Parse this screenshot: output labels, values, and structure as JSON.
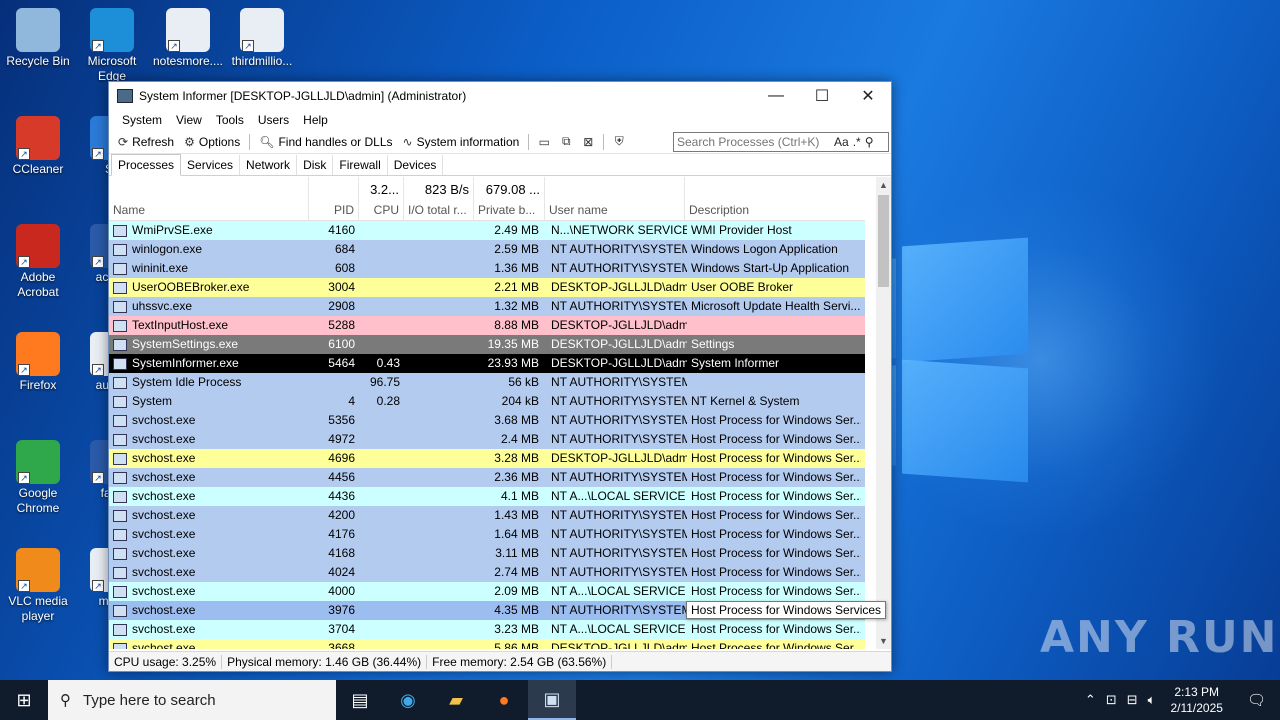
{
  "desktop": {
    "icons": [
      {
        "label": "Recycle Bin",
        "color": "#8fb8dc"
      },
      {
        "label": "Microsoft Edge",
        "color": "#1c8fd8"
      },
      {
        "label": "notesmore....",
        "color": "#e8eef4"
      },
      {
        "label": "thirdmillio...",
        "color": "#e8eef4"
      },
      {
        "label": "CCleaner",
        "color": "#d83a2a"
      },
      {
        "label": "Sk",
        "color": "#2a7ad8"
      },
      {
        "label": "Adobe Acrobat",
        "color": "#c8281e"
      },
      {
        "label": "acade",
        "color": "#2a5aa8"
      },
      {
        "label": "Firefox",
        "color": "#ff7a1e"
      },
      {
        "label": "augus",
        "color": "#e8eef4"
      },
      {
        "label": "Google Chrome",
        "color": "#2ea84a"
      },
      {
        "label": "fami",
        "color": "#2a5aa8"
      },
      {
        "label": "VLC media player",
        "color": "#f08a1a"
      },
      {
        "label": "moth",
        "color": "#e8eef4"
      }
    ],
    "watermark": "ANY RUN"
  },
  "window": {
    "title": "System Informer [DESKTOP-JGLLJLD\\admin] (Administrator)",
    "controls": {
      "minimize": "—",
      "maximize": "☐",
      "close": "✕"
    },
    "menu": [
      "System",
      "View",
      "Tools",
      "Users",
      "Help"
    ],
    "toolbar": {
      "refresh": "Refresh",
      "options": "Options",
      "find_handles": "Find handles or DLLs",
      "system_information": "System information"
    },
    "search": {
      "placeholder": "Search Processes (Ctrl+K)",
      "case_option": "Aa",
      "regex_option": ".*"
    },
    "tabs": [
      "Processes",
      "Services",
      "Network",
      "Disk",
      "Firewall",
      "Devices"
    ],
    "active_tab": "Processes",
    "columns": {
      "name": {
        "label": "Name",
        "summary": ""
      },
      "pid": {
        "label": "PID",
        "summary": ""
      },
      "cpu": {
        "label": "CPU",
        "summary": "3.2..."
      },
      "io": {
        "label": "I/O total r...",
        "summary": "823 B/s"
      },
      "private": {
        "label": "Private b...",
        "summary": "679.08 ..."
      },
      "user": {
        "label": "User name",
        "summary": ""
      },
      "desc": {
        "label": "Description",
        "summary": ""
      }
    },
    "processes": [
      {
        "name": "WmiPrvSE.exe",
        "pid": "4160",
        "cpu": "",
        "io": "",
        "private": "2.49 MB",
        "user": "N...\\NETWORK SERVICE",
        "desc": "WMI Provider Host",
        "bg": "#ccffff",
        "fg": "#000000"
      },
      {
        "name": "winlogon.exe",
        "pid": "684",
        "cpu": "",
        "io": "",
        "private": "2.59 MB",
        "user": "NT AUTHORITY\\SYSTEM",
        "desc": "Windows Logon Application",
        "bg": "#b4cbf0",
        "fg": "#000000"
      },
      {
        "name": "wininit.exe",
        "pid": "608",
        "cpu": "",
        "io": "",
        "private": "1.36 MB",
        "user": "NT AUTHORITY\\SYSTEM",
        "desc": "Windows Start-Up Application",
        "bg": "#b4cbf0",
        "fg": "#000000"
      },
      {
        "name": "UserOOBEBroker.exe",
        "pid": "3004",
        "cpu": "",
        "io": "",
        "private": "2.21 MB",
        "user": "DESKTOP-JGLLJLD\\admi",
        "desc": "User OOBE Broker",
        "bg": "#ffff99",
        "fg": "#000000"
      },
      {
        "name": "uhssvc.exe",
        "pid": "2908",
        "cpu": "",
        "io": "",
        "private": "1.32 MB",
        "user": "NT AUTHORITY\\SYSTEM",
        "desc": "Microsoft Update Health Servi...",
        "bg": "#b4cbf0",
        "fg": "#000000"
      },
      {
        "name": "TextInputHost.exe",
        "pid": "5288",
        "cpu": "",
        "io": "",
        "private": "8.88 MB",
        "user": "DESKTOP-JGLLJLD\\admi",
        "desc": "",
        "bg": "#ffc0cb",
        "fg": "#000000"
      },
      {
        "name": "SystemSettings.exe",
        "pid": "6100",
        "cpu": "",
        "io": "",
        "private": "19.35 MB",
        "user": "DESKTOP-JGLLJLD\\admi",
        "desc": "Settings",
        "bg": "#7a7a7a",
        "fg": "#ffffff"
      },
      {
        "name": "SystemInformer.exe",
        "pid": "5464",
        "cpu": "0.43",
        "io": "",
        "private": "23.93 MB",
        "user": "DESKTOP-JGLLJLD\\admi",
        "desc": "System Informer",
        "bg": "#000000",
        "fg": "#ffffff"
      },
      {
        "name": "System Idle Process",
        "pid": "",
        "cpu": "96.75",
        "io": "",
        "private": "56 kB",
        "user": "NT AUTHORITY\\SYSTEM",
        "desc": "",
        "bg": "#b4cbf0",
        "fg": "#000000"
      },
      {
        "name": "System",
        "pid": "4",
        "cpu": "0.28",
        "io": "",
        "private": "204 kB",
        "user": "NT AUTHORITY\\SYSTEM",
        "desc": "NT Kernel & System",
        "bg": "#b4cbf0",
        "fg": "#000000"
      },
      {
        "name": "svchost.exe",
        "pid": "5356",
        "cpu": "",
        "io": "",
        "private": "3.68 MB",
        "user": "NT AUTHORITY\\SYSTEM",
        "desc": "Host Process for Windows Ser...",
        "bg": "#b4cbf0",
        "fg": "#000000"
      },
      {
        "name": "svchost.exe",
        "pid": "4972",
        "cpu": "",
        "io": "",
        "private": "2.4 MB",
        "user": "NT AUTHORITY\\SYSTEM",
        "desc": "Host Process for Windows Ser...",
        "bg": "#b4cbf0",
        "fg": "#000000"
      },
      {
        "name": "svchost.exe",
        "pid": "4696",
        "cpu": "",
        "io": "",
        "private": "3.28 MB",
        "user": "DESKTOP-JGLLJLD\\admi",
        "desc": "Host Process for Windows Ser...",
        "bg": "#ffff99",
        "fg": "#000000"
      },
      {
        "name": "svchost.exe",
        "pid": "4456",
        "cpu": "",
        "io": "",
        "private": "2.36 MB",
        "user": "NT AUTHORITY\\SYSTEM",
        "desc": "Host Process for Windows Ser...",
        "bg": "#b4cbf0",
        "fg": "#000000"
      },
      {
        "name": "svchost.exe",
        "pid": "4436",
        "cpu": "",
        "io": "",
        "private": "4.1 MB",
        "user": "NT A...\\LOCAL SERVICE",
        "desc": "Host Process for Windows Ser...",
        "bg": "#ccffff",
        "fg": "#000000"
      },
      {
        "name": "svchost.exe",
        "pid": "4200",
        "cpu": "",
        "io": "",
        "private": "1.43 MB",
        "user": "NT AUTHORITY\\SYSTEM",
        "desc": "Host Process for Windows Ser...",
        "bg": "#b4cbf0",
        "fg": "#000000"
      },
      {
        "name": "svchost.exe",
        "pid": "4176",
        "cpu": "",
        "io": "",
        "private": "1.64 MB",
        "user": "NT AUTHORITY\\SYSTEM",
        "desc": "Host Process for Windows Ser...",
        "bg": "#b4cbf0",
        "fg": "#000000"
      },
      {
        "name": "svchost.exe",
        "pid": "4168",
        "cpu": "",
        "io": "",
        "private": "3.11 MB",
        "user": "NT AUTHORITY\\SYSTEM",
        "desc": "Host Process for Windows Ser...",
        "bg": "#b4cbf0",
        "fg": "#000000"
      },
      {
        "name": "svchost.exe",
        "pid": "4024",
        "cpu": "",
        "io": "",
        "private": "2.74 MB",
        "user": "NT AUTHORITY\\SYSTEM",
        "desc": "Host Process for Windows Ser...",
        "bg": "#b4cbf0",
        "fg": "#000000"
      },
      {
        "name": "svchost.exe",
        "pid": "4000",
        "cpu": "",
        "io": "",
        "private": "2.09 MB",
        "user": "NT A...\\LOCAL SERVICE",
        "desc": "Host Process for Windows Ser...",
        "bg": "#ccffff",
        "fg": "#000000"
      },
      {
        "name": "svchost.exe",
        "pid": "3976",
        "cpu": "",
        "io": "",
        "private": "4.35 MB",
        "user": "NT AUTHORITY\\SYSTEM",
        "desc": "Host Process for Windows Ser...",
        "bg": "#9cbdf0",
        "fg": "#000000"
      },
      {
        "name": "svchost.exe",
        "pid": "3704",
        "cpu": "",
        "io": "",
        "private": "3.23 MB",
        "user": "NT A...\\LOCAL SERVICE",
        "desc": "Host Process for Windows Ser...",
        "bg": "#ccffff",
        "fg": "#000000"
      },
      {
        "name": "svchost.exe",
        "pid": "3668",
        "cpu": "",
        "io": "",
        "private": "5.86 MB",
        "user": "DESKTOP-JGLLJLD\\admi",
        "desc": "Host Process for Windows Ser...",
        "bg": "#ffff99",
        "fg": "#000000"
      }
    ],
    "tooltip": "Host Process for Windows Services",
    "status": {
      "cpu": "CPU usage: 3.25%",
      "physical": "Physical memory: 1.46 GB (36.44%)",
      "free": "Free memory: 2.54 GB (63.56%)"
    }
  },
  "taskbar": {
    "search_placeholder": "Type here to search",
    "time": "2:13 PM",
    "date": "2/11/2025"
  }
}
